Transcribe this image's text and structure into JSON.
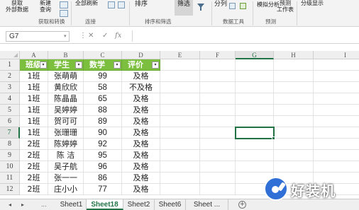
{
  "ribbon": {
    "get_data": [
      "获取",
      "外部数据"
    ],
    "new_query": [
      "新建",
      "查询"
    ],
    "refresh_all": [
      "全部刷新"
    ],
    "sort": "排序",
    "filter": "筛选",
    "split": "分列",
    "whatif": "模拟分析",
    "forecast": [
      "预测",
      "工作表"
    ],
    "outline": "分级显示",
    "groups": [
      "获取和转换",
      "连接",
      "排序和筛选",
      "数据工具",
      "预测"
    ]
  },
  "formula_bar": {
    "name_box": "G7",
    "cancel": "✕",
    "enter": "✓",
    "fx": "fx",
    "value": ""
  },
  "columns": [
    "A",
    "B",
    "C",
    "D",
    "E",
    "F",
    "G",
    "H",
    "I"
  ],
  "rows": [
    "1",
    "2",
    "3",
    "4",
    "5",
    "6",
    "7",
    "8",
    "9",
    "10",
    "11",
    "12"
  ],
  "table": {
    "headers": [
      "班级",
      "学生",
      "数学",
      "评价"
    ],
    "records": [
      [
        "1班",
        "张萌萌",
        "99",
        "及格"
      ],
      [
        "1班",
        "黄欣欣",
        "58",
        "不及格"
      ],
      [
        "1班",
        "陈晶晶",
        "65",
        "及格"
      ],
      [
        "1班",
        "吴婷婷",
        "88",
        "及格"
      ],
      [
        "1班",
        "贺可可",
        "89",
        "及格"
      ],
      [
        "1班",
        "张珊珊",
        "90",
        "及格"
      ],
      [
        "2班",
        "陈婷婷",
        "92",
        "及格"
      ],
      [
        "2班",
        "陈  洁",
        "95",
        "及格"
      ],
      [
        "2班",
        "吴子航",
        "96",
        "及格"
      ],
      [
        "2班",
        "张一一",
        "86",
        "及格"
      ],
      [
        "2班",
        "庄小小",
        "77",
        "及格"
      ]
    ]
  },
  "selection": {
    "cell": "G7",
    "row": "7",
    "column": "G"
  },
  "sheet_tabs": {
    "nav": [
      "◂",
      "▸",
      "..."
    ],
    "tabs": [
      "Sheet1",
      "Sheet18",
      "Sheet2",
      "Sheet6",
      "Sheet ..."
    ],
    "active": "Sheet18",
    "add": "+"
  },
  "watermark": {
    "text": "好装机"
  },
  "colors": {
    "header_fill": "#7cbf3e",
    "accent": "#217346"
  }
}
